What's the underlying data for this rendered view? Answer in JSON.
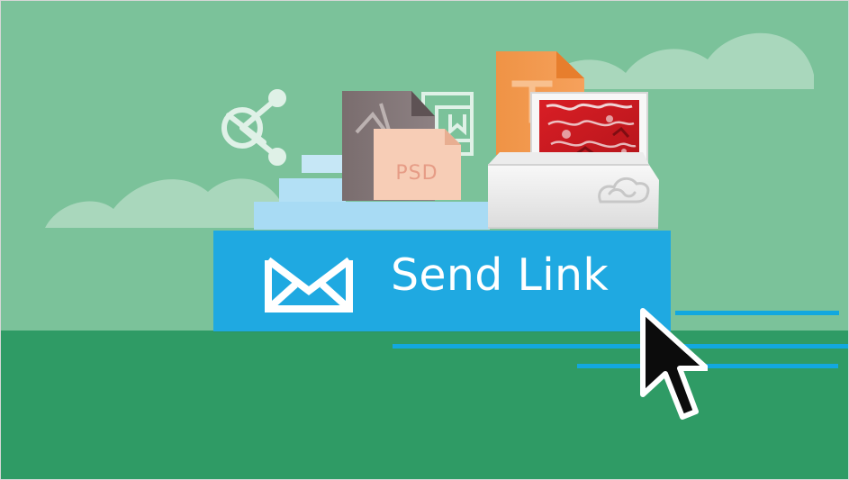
{
  "scene": {
    "psd_label": "PSD",
    "send_button_label": "Send Link"
  },
  "icons": {
    "share": "share-icon",
    "mail": "mail-icon",
    "creative_cloud": "creative-cloud-icon",
    "cursor": "pointer-cursor-icon"
  },
  "colors": {
    "sky": "#7bc29a",
    "ground": "#2f9b65",
    "button": "#1fa9e1",
    "accent_lines": "#12a8df",
    "cloud": "#a9d7bc"
  }
}
